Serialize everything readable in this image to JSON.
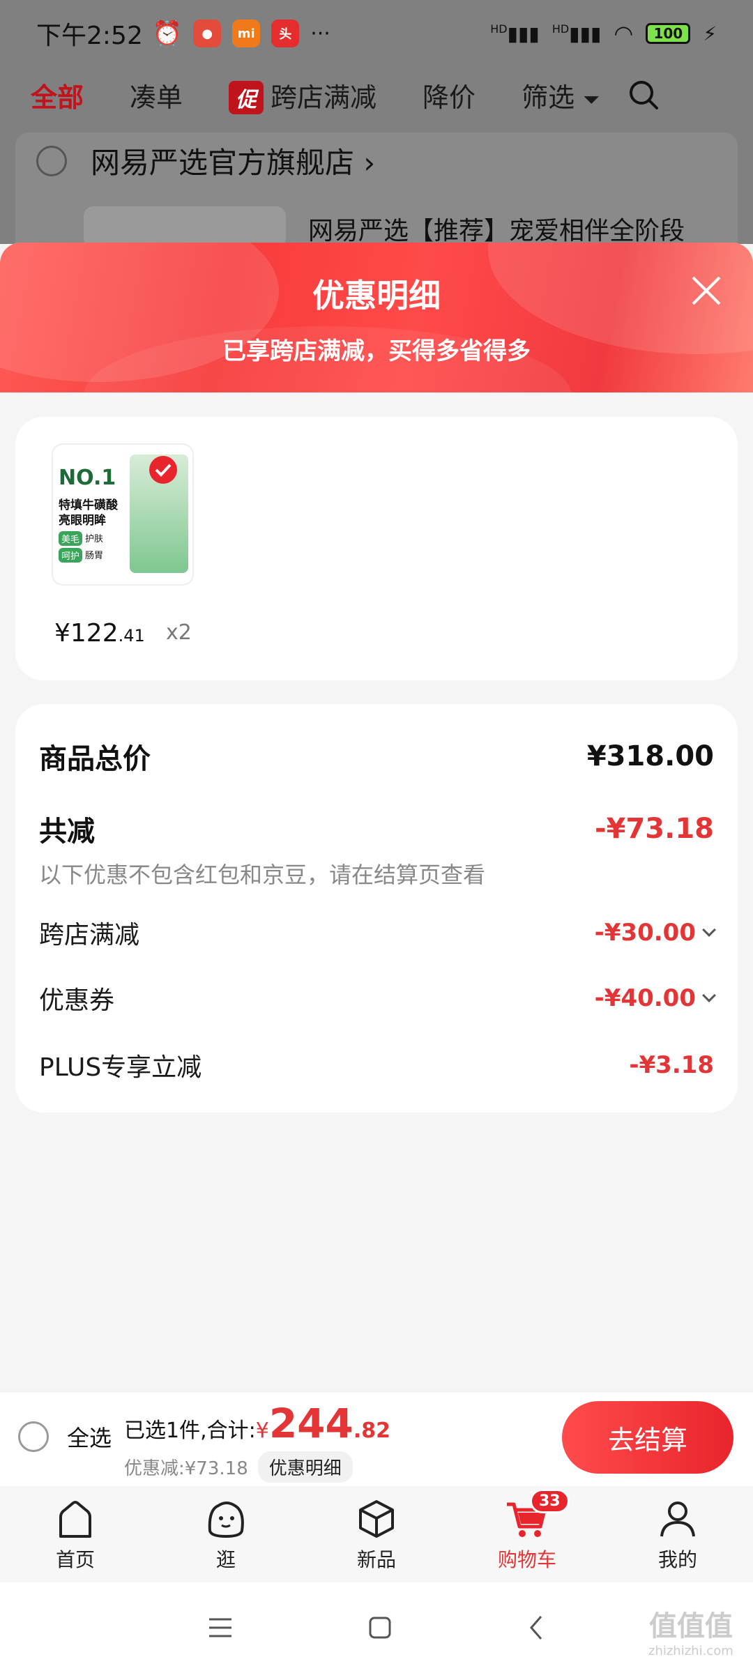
{
  "status_bar": {
    "time": "下午2:52",
    "more": "···",
    "signal1": "HD",
    "signal2": "HD",
    "battery": "100"
  },
  "filter_tabs": [
    {
      "label": "全部",
      "active": true
    },
    {
      "label": "凑单"
    },
    {
      "label": "跨店满减",
      "badge": "促"
    },
    {
      "label": "降价"
    },
    {
      "label": "筛选"
    }
  ],
  "background_shop": {
    "name": "网易严选官方旗舰店 ›",
    "product_title": "网易严选【推荐】宠爱相伴全阶段"
  },
  "panel": {
    "title": "优惠明细",
    "subtitle": "已享跨店满减，买得多省得多",
    "item": {
      "price_int": "¥122",
      "price_dec": ".41",
      "qty": "x2",
      "image_text_1": "NO.1",
      "image_text_2": "特填牛磺酸",
      "image_text_3": "亮眼明眸",
      "image_tag_1": "美毛",
      "image_tag_2": "护肤",
      "image_tag_3": "呵护",
      "image_tag_4": "肠胃"
    },
    "summary": {
      "total_label": "商品总价",
      "total_value": "¥318.00",
      "reduce_label": "共减",
      "reduce_value": "-¥73.18",
      "note": "以下优惠不包含红包和京豆，请在结算页查看",
      "lines": [
        {
          "label": "跨店满减",
          "value": "-¥30.00",
          "expandable": true
        },
        {
          "label": "优惠券",
          "value": "-¥40.00",
          "expandable": true
        },
        {
          "label": "PLUS专享立减",
          "value": "-¥3.18",
          "expandable": false
        }
      ]
    }
  },
  "bottom_bar": {
    "select_all": "全选",
    "selected_prefix": "已选1件,合计:",
    "currency": "¥",
    "total_int": "244",
    "total_dec": ".82",
    "discount_text": "优惠减:¥73.18",
    "detail_button": "优惠明细",
    "checkout": "去结算"
  },
  "tab_bar": [
    {
      "label": "首页",
      "icon": "home-icon"
    },
    {
      "label": "逛",
      "icon": "browse-face-icon"
    },
    {
      "label": "新品",
      "icon": "box-icon"
    },
    {
      "label": "购物车",
      "icon": "cart-icon",
      "badge": "33",
      "active": true
    },
    {
      "label": "我的",
      "icon": "profile-icon"
    }
  ],
  "watermark": {
    "text": "值值值",
    "url": "zhizhizhi.com"
  },
  "colors": {
    "accent": "#e33535",
    "brand_red": "#c0131c",
    "banner": "#f73b3b"
  }
}
